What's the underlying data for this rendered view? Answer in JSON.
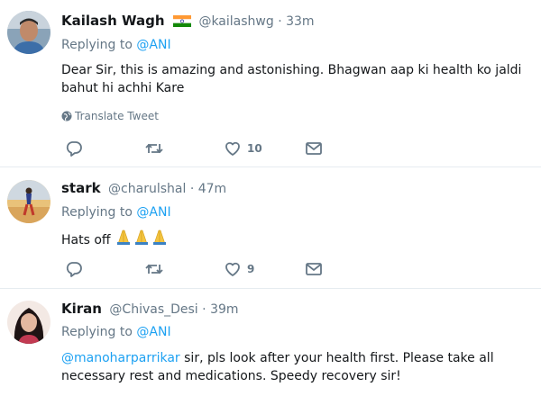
{
  "colors": {
    "accent": "#1da1f2",
    "muted": "#657786",
    "text": "#14171a",
    "divider": "#e6ecf0"
  },
  "tweets": [
    {
      "name": "Kailash Wagh",
      "flag": "india-flag-icon",
      "handle": "@kailashwg",
      "sep": "·",
      "time": "33m",
      "replying_prefix": "Replying to ",
      "replying_to": "@ANI",
      "text": "Dear Sir, this is amazing and astonishing. Bhagwan aap ki health ko jaldi bahut hi achhi Kare",
      "translate_label": "Translate Tweet",
      "likes": "10"
    },
    {
      "name": "stark",
      "handle": "@charulshal",
      "sep": "·",
      "time": "47m",
      "replying_prefix": "Replying to ",
      "replying_to": "@ANI",
      "text": "Hats off",
      "emoji": "folded-hands-icon",
      "likes": "9"
    },
    {
      "name": "Kiran",
      "handle": "@Chivas_Desi",
      "sep": "·",
      "time": "39m",
      "replying_prefix": "Replying to ",
      "replying_to": "@ANI",
      "mention": "@manoharparrikar",
      "text": " sir, pls look after your health first. Please take all necessary rest and medications. Speedy recovery sir!"
    }
  ]
}
